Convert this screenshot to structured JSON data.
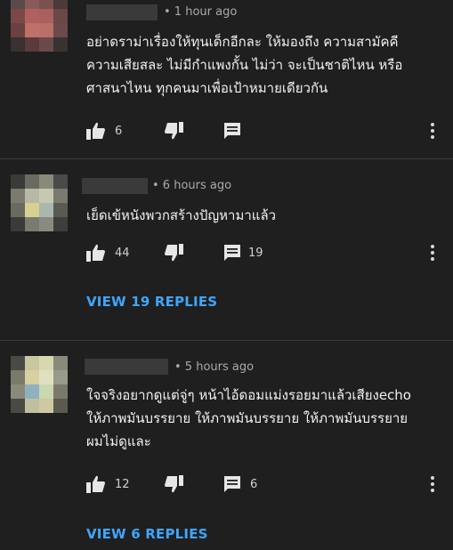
{
  "comments": [
    {
      "time": "• 1 hour ago",
      "text": "อย่าดราม่าเรื่องให้ทุนเด็กอีกละ  ให้มองถึง ความสามัคคี\nความเสียสละ  ไม่มีกำแพงกั้น ไม่ว่า จะเป็นชาติไหน หรือ\nศาสนาไหน ทุกคนมาเพื่อเป้าหมายเดียวกัน",
      "likes": "6",
      "replies_count": ""
    },
    {
      "time": "• 6 hours ago",
      "text": "เย็ดเข้หนังพวกสร้างปัญหามาแล้ว",
      "likes": "44",
      "replies_count": "19",
      "view_replies": "VIEW 19 REPLIES"
    },
    {
      "time": "• 5 hours ago",
      "text": "ใจจริงอยากดูแต่จู่ๆ หน้าไอ้ดอมแม่งรอยมาแล้วเสียงecho\nให้ภาพมันบรรยาย ให้ภาพมันบรรยาย ให้ภาพมันบรรยาย\nผมไม่ดูและ",
      "likes": "12",
      "replies_count": "6",
      "view_replies": "VIEW 6 REPLIES"
    }
  ],
  "colors": {
    "background": "#1f1f1f",
    "text": "#f1f1f1",
    "meta": "#aaaaaa",
    "link": "#3ea6ff",
    "divider": "#3a3a3a"
  },
  "icons": [
    "thumb-up-icon",
    "thumb-down-icon",
    "reply-icon",
    "more-vert-icon"
  ]
}
